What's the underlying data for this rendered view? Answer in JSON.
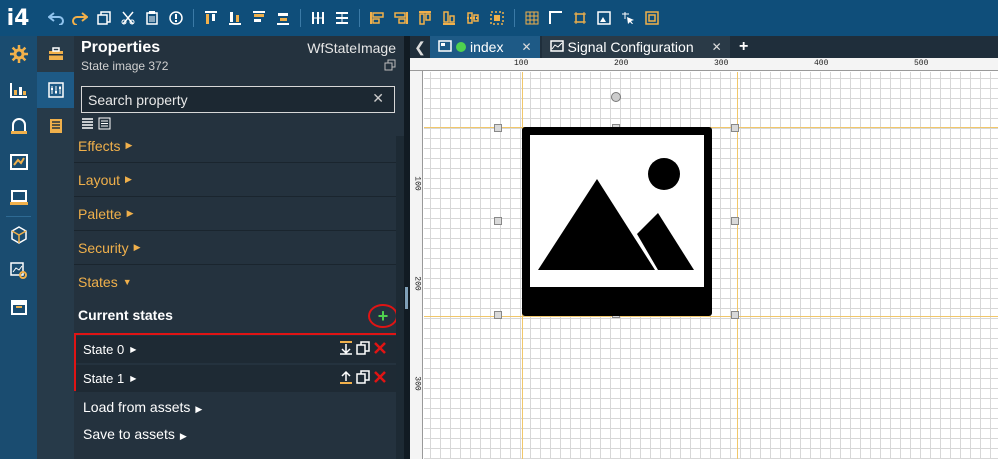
{
  "app": {
    "logo": "i4"
  },
  "toolbar": {
    "groups": [
      [
        "undo-icon",
        "redo-icon",
        "copy-icon",
        "cut-icon",
        "paste-icon",
        "info-icon"
      ],
      [
        "align-top-icon",
        "align-bottom-icon",
        "align-middle-icon",
        "distribute-icon",
        "center-h-icon",
        "center-v-icon"
      ],
      [
        "align-left-icon",
        "align-right-icon",
        "align-top-edge-icon",
        "align-bottom-edge-icon",
        "align-center-icon",
        "select-frame-icon"
      ],
      [
        "grid-icon",
        "corner-icon",
        "frame-icon",
        "image-select-icon",
        "pointer-icon",
        "zoom-frame-icon"
      ]
    ]
  },
  "rail": [
    "gear-icon",
    "dashboard-icon",
    "alarm-icon",
    "report-icon",
    "terminal-icon",
    "cube-icon",
    "chart-gear-icon",
    "archive-icon"
  ],
  "panel": {
    "title": "Properties",
    "type": "WfStateImage",
    "subtitle": "State image 372",
    "search_placeholder": "Search property",
    "sections": [
      "Effects",
      "Layout",
      "Palette",
      "Security",
      "States"
    ],
    "current_states_label": "Current states",
    "add_symbol": "+",
    "states": [
      "State 0",
      "State 1"
    ],
    "load_label": "Load from assets",
    "save_label": "Save to assets"
  },
  "tabs": [
    {
      "label": "index",
      "active": true
    },
    {
      "label": "Signal Configuration",
      "active": false
    }
  ],
  "tab_close": "✕",
  "ruler": {
    "top": [
      "100",
      "200",
      "300",
      "400",
      "500"
    ],
    "left": [
      "100",
      "200",
      "300"
    ]
  },
  "colors": {
    "accent": "#f0b04b",
    "toolbar": "#0f4e7a",
    "highlight": "#e01414",
    "add": "#4fd24f"
  }
}
